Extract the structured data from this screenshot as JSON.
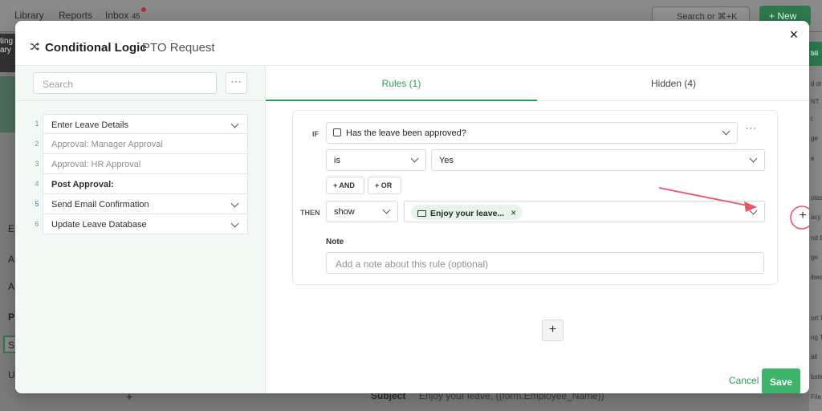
{
  "background": {
    "nav": [
      "Library",
      "Reports",
      "Inbox"
    ],
    "inbox_count": "45",
    "search_placeholder": "Search or ⌘+K",
    "new_button": "+ New",
    "left_letters": [
      "E",
      "A",
      "A",
      "P",
      "S",
      "U"
    ],
    "left_dark_text": [
      "ting",
      "ary"
    ],
    "right_texts": [
      "bli",
      "d dr",
      "NT",
      "t",
      "ge",
      "e",
      "otas",
      "acy",
      "nd E",
      "ge",
      "ibed",
      "ort T",
      "ng T",
      "ail",
      "bsite",
      "File"
    ],
    "bottom_subject_label": "Subject",
    "bottom_subject_value": "Enjoy your leave, {{form.Employee_Name}}"
  },
  "modal": {
    "title": "Conditional Logic",
    "subtitle": "PTO Request",
    "close": "×"
  },
  "sidebar": {
    "search_placeholder": "Search",
    "more": "···",
    "steps": [
      {
        "num": "1",
        "label": "Enter Leave Details"
      },
      {
        "num": "2",
        "label": "Approval: Manager Approval"
      },
      {
        "num": "3",
        "label": "Approval: HR Approval"
      },
      {
        "num": "4",
        "label": "Post Approval:"
      },
      {
        "num": "5",
        "label": "Send Email Confirmation"
      },
      {
        "num": "6",
        "label": "Update Leave Database"
      }
    ]
  },
  "tabs": {
    "rules": "Rules (1)",
    "hidden": "Hidden (4)"
  },
  "rule": {
    "if_label": "IF",
    "then_label": "THEN",
    "condition_field": "Has the leave been approved?",
    "operator": "is",
    "value": "Yes",
    "and_button": "+ AND",
    "or_button": "+ OR",
    "action": "show",
    "target_chip": "Enjoy your leave...",
    "chip_remove": "×",
    "more": "···",
    "note_label": "Note",
    "note_placeholder": "Add a note about this rule (optional)"
  },
  "add_rule": "+",
  "side_add": "+",
  "footer": {
    "cancel": "Cancel",
    "save": "Save"
  },
  "colors": {
    "accent": "#2f9a5c",
    "save_bg": "#3cb46c",
    "annotation": "#e8536d",
    "sidebar_bg": "#f2f8f4"
  }
}
